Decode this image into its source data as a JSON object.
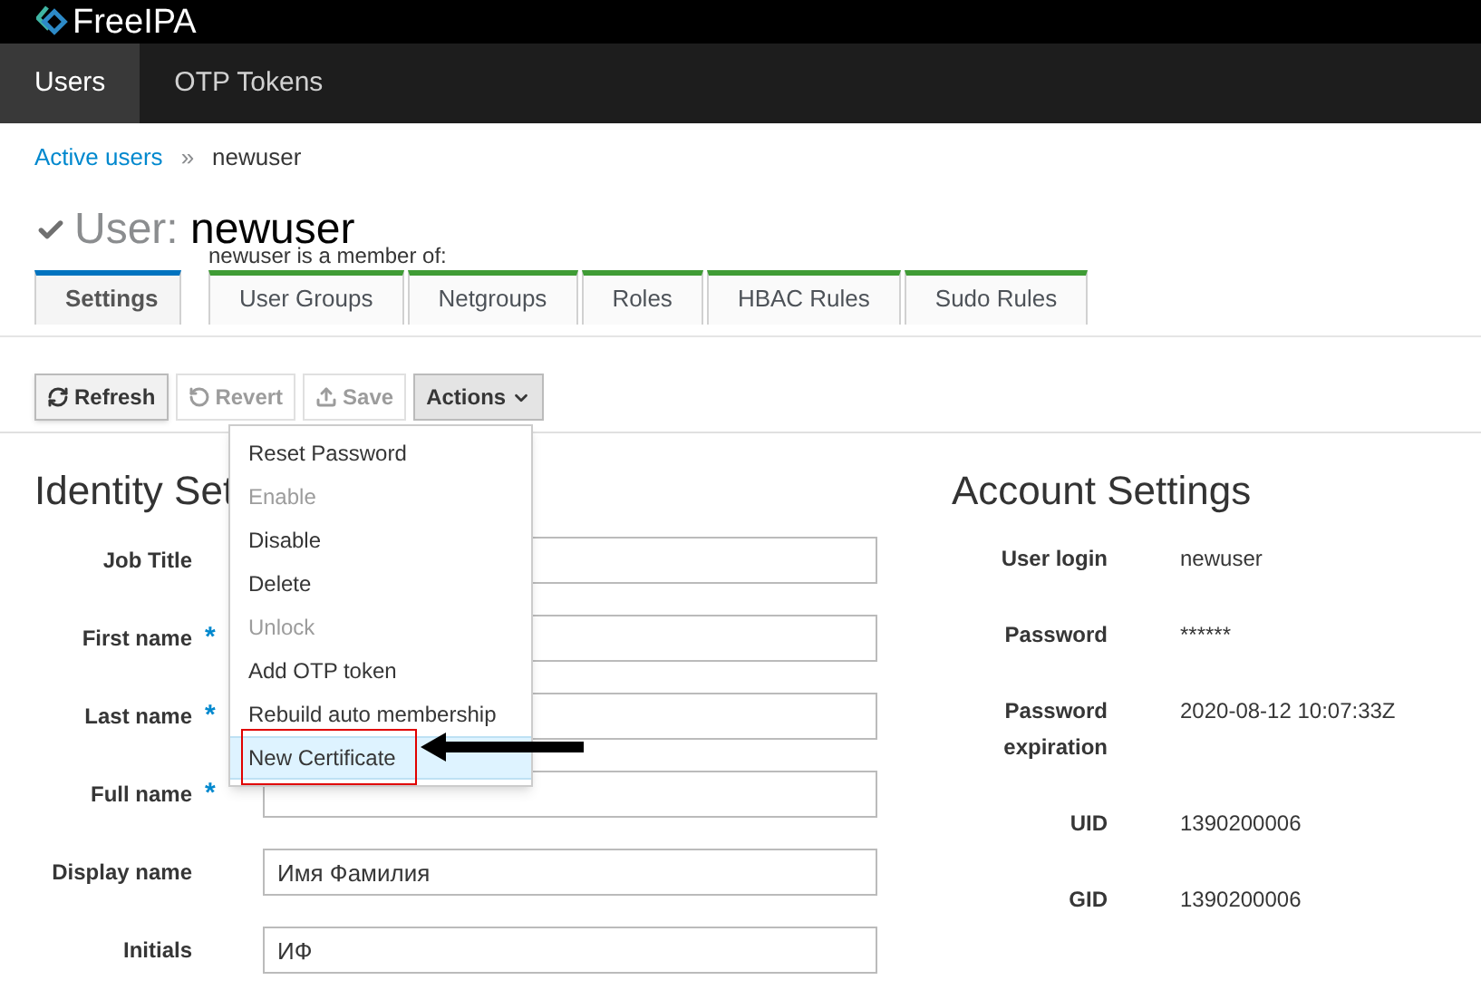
{
  "brand": "FreeIPA",
  "nav": [
    {
      "label": "Users",
      "selected": true
    },
    {
      "label": "OTP Tokens",
      "selected": false
    }
  ],
  "breadcrumb": {
    "link": "Active users",
    "separator": "»",
    "current": "newuser"
  },
  "page_title": {
    "prefix": "User:",
    "name": "newuser"
  },
  "member_of_label": "newuser is a member of:",
  "tabs": [
    {
      "label": "Settings",
      "selected": true,
      "kind": "settings"
    },
    {
      "label": "User Groups",
      "selected": false,
      "kind": "member"
    },
    {
      "label": "Netgroups",
      "selected": false,
      "kind": "member"
    },
    {
      "label": "Roles",
      "selected": false,
      "kind": "member"
    },
    {
      "label": "HBAC Rules",
      "selected": false,
      "kind": "member"
    },
    {
      "label": "Sudo Rules",
      "selected": false,
      "kind": "member"
    }
  ],
  "toolbar": [
    {
      "label": "Refresh",
      "kind": "refresh",
      "disabled": false
    },
    {
      "label": "Revert",
      "kind": "revert",
      "disabled": true
    },
    {
      "label": "Save",
      "kind": "save",
      "disabled": true
    },
    {
      "label": "Actions",
      "kind": "actions",
      "disabled": false
    }
  ],
  "actions_menu": [
    {
      "label": "Reset Password",
      "disabled": false,
      "selected": false
    },
    {
      "label": "Enable",
      "disabled": true,
      "selected": false
    },
    {
      "label": "Disable",
      "disabled": false,
      "selected": false
    },
    {
      "label": "Delete",
      "disabled": false,
      "selected": false
    },
    {
      "label": "Unlock",
      "disabled": true,
      "selected": false
    },
    {
      "label": "Add OTP token",
      "disabled": false,
      "selected": false
    },
    {
      "label": "Rebuild auto membership",
      "disabled": false,
      "selected": false
    },
    {
      "label": "New Certificate",
      "disabled": false,
      "selected": true
    }
  ],
  "identity": {
    "title": "Identity Set",
    "fields": [
      {
        "label": "Job Title"
      },
      {
        "label": "First name",
        "marker": "*"
      },
      {
        "label": "Last name",
        "marker": "*"
      },
      {
        "label": "Full name",
        "marker": "*"
      },
      {
        "label": "Display name",
        "value": "Имя Фамилия"
      },
      {
        "label": "Initials",
        "value": "ИФ"
      }
    ]
  },
  "account": {
    "title": "Account Settings",
    "rows": [
      {
        "label": "User login",
        "value": "newuser"
      },
      {
        "label": "Password",
        "value": "******"
      },
      {
        "label": "Password expiration",
        "value": "2020-08-12 10:07:33Z"
      },
      {
        "label": "UID",
        "value": "1390200006"
      },
      {
        "label": "GID",
        "value": "1390200006"
      }
    ]
  }
}
